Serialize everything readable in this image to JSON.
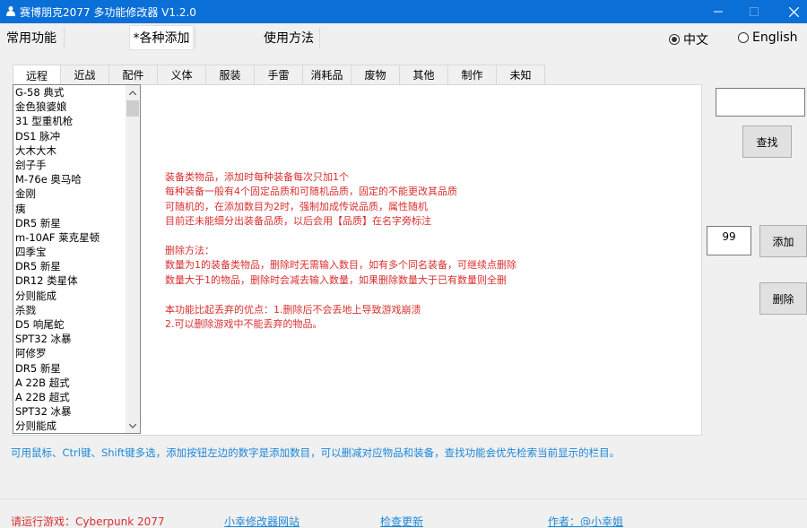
{
  "window": {
    "title": "赛博朋克2077 多功能修改器 V1.2.0"
  },
  "menu": {
    "common": "常用功能",
    "add_various": "*各种添加",
    "usage": "使用方法"
  },
  "language": {
    "chinese": "中文",
    "english": "English",
    "selected": "中文"
  },
  "tabs": [
    "远程",
    "近战",
    "配件",
    "义体",
    "服装",
    "手雷",
    "消耗品",
    "废物",
    "其他",
    "制作",
    "未知"
  ],
  "active_tab": "远程",
  "item_list": [
    "G-58 典式",
    "金色狼婆娘",
    "31 型重机枪",
    "DS1 脉冲",
    "大木大木",
    "刽子手",
    "M-76e 奥马哈",
    "金刚",
    "痍",
    "DR5 新星",
    "m-10AF 莱克星顿",
    "四季宝",
    "DR5 新星",
    "DR12 类星体",
    "分则能成",
    "杀戮",
    "D5 响尾蛇",
    "SPT32 冰暴",
    "阿修罗",
    "DR5 新星",
    "A 22B 超式",
    "A 22B 超式",
    "SPT32 冰暴",
    "分则能成"
  ],
  "info": {
    "equipment_lines": [
      "装备类物品，添加时每种装备每次只加1个",
      "每种装备一般有4个固定品质和可随机品质，固定的不能更改其品质",
      "可随机的，在添加数目为2时，强制加成传说品质，属性随机",
      "目前还未能细分出装备品质，以后会用【品质】在名字旁标注"
    ],
    "delete_title": "删除方法：",
    "delete_lines": [
      "数量为1的装备类物品，删除时无需输入数目，如有多个同名装备，可继续点删除",
      "数量大于1的物品，删除时会减去输入数量，如果删除数量大于已有数量则全删"
    ],
    "advantage_lines": [
      "本功能比起丢弃的优点：1.删除后不会丢地上导致游戏崩溃",
      "2.可以删除游戏中不能丢弃的物品。"
    ]
  },
  "side": {
    "search_value": "",
    "search_button": "查找",
    "quantity": "99",
    "add_button": "添加",
    "delete_button": "删除"
  },
  "hint_text": "可用鼠标、Ctrl键、Shift键多选，添加按钮左边的数字是添加数目，可以删减对应物品和装备，查找功能会优先检索当前显示的栏目。",
  "status": {
    "run_game": "请运行游戏：Cyberpunk 2077",
    "site_link": "小幸修改器网站",
    "update_link": "检查更新",
    "author_link": "作者：@小幸姐"
  },
  "colors": {
    "titlebar": "#0b6fd8",
    "info_text": "#d83030",
    "link": "#1e88d8"
  }
}
